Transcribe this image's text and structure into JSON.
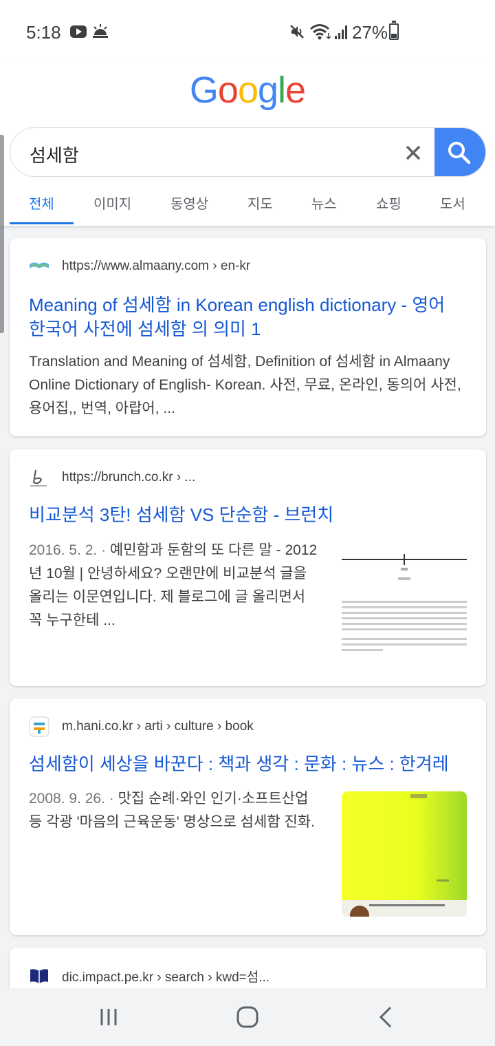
{
  "status": {
    "time": "5:18",
    "battery": "27%"
  },
  "logo": "Google",
  "search": {
    "query": "섬세함"
  },
  "tabs": [
    "전체",
    "이미지",
    "동영상",
    "지도",
    "뉴스",
    "쇼핑",
    "도서"
  ],
  "results": [
    {
      "url": "https://www.almaany.com › en-kr",
      "title": "Meaning of 섬세함 in Korean english dictionary - 영어 한국어 사전에 섬세함 의 의미 1",
      "snippet": "Translation and Meaning of 섬세함, Definition of 섬세함 in Almaany Online Dictionary of English- Korean. 사전, 무료, 온라인, 동의어 사전, 용어집,, 번역, 아랍어, ..."
    },
    {
      "url": "https://brunch.co.kr › ...",
      "title": "비교분석 3탄! 섬세함 VS 단순함 - 브런치",
      "date": "2016. 5. 2. · ",
      "snippet": "예민함과 둔함의 또 다른 말 - 2012년 10월 | 안녕하세요? 오랜만에 비교분석 글을 올리는 이문연입니다. 제 블로그에 글 올리면서 꼭 누구한테 ..."
    },
    {
      "url": "m.hani.co.kr › arti › culture › book",
      "title": "섬세함이 세상을 바꾼다 : 책과 생각 : 문화 : 뉴스 : 한겨레",
      "date": "2008. 9. 26. · ",
      "snippet": "맛집 순례·와인 인기·소프트산업 등 각광 '마음의 근육운동' 명상으로 섬세함 진화."
    },
    {
      "url": "dic.impact.pe.kr › search › kwd=섬..."
    }
  ],
  "colors": {
    "link": "#1558d6",
    "accent": "#4285f4",
    "logo": [
      "#4285f4",
      "#ea4335",
      "#fbbc05",
      "#4285f4",
      "#34a853",
      "#ea4335"
    ]
  }
}
